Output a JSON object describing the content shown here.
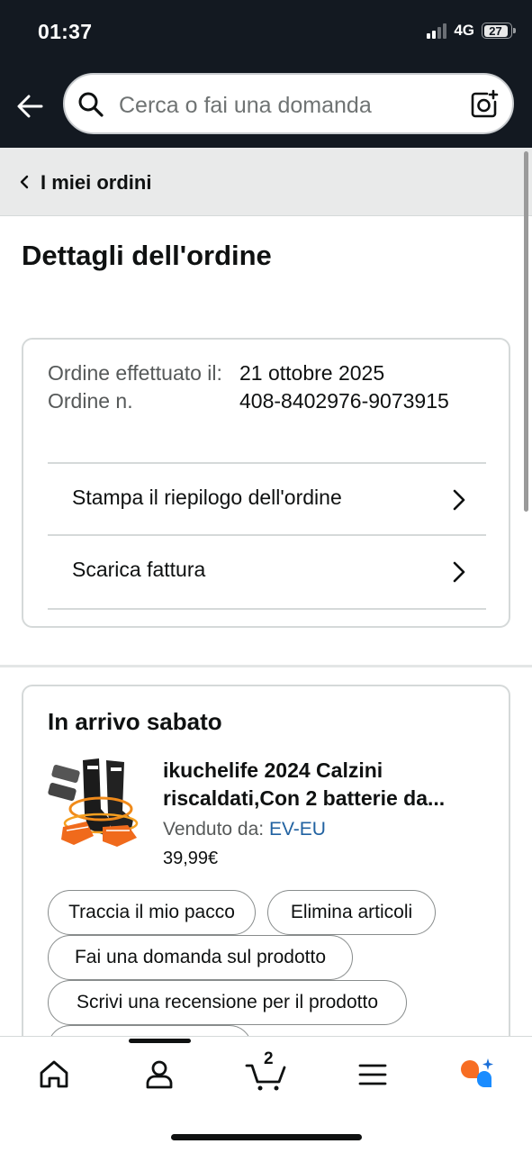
{
  "status_bar": {
    "time": "01:37",
    "network": "4G",
    "battery": "27"
  },
  "search": {
    "placeholder": "Cerca o fai una domanda"
  },
  "breadcrumb": {
    "label": "I miei ordini"
  },
  "page": {
    "title": "Dettagli dell'ordine"
  },
  "order": {
    "date_label": "Ordine effettuato il:",
    "number_label": "Ordine n.",
    "date_value": "21 ottobre 2025",
    "number_value": "408-8402976-9073915",
    "links": [
      {
        "label": "Stampa il riepilogo dell'ordine"
      },
      {
        "label": "Scarica fattura"
      }
    ]
  },
  "shipment": {
    "title": "In arrivo sabato",
    "product": {
      "name_line1": "ikuchelife 2024 Calzini",
      "name_line2": "riscaldati,Con 2 batterie da...",
      "seller_prefix": "Venduto da:",
      "seller_name": "EV-EU",
      "price": "39,99€"
    },
    "actions": [
      {
        "label": "Traccia il mio pacco"
      },
      {
        "label": "Elimina articoli"
      },
      {
        "label": "Fai una domanda sul prodotto"
      },
      {
        "label": "Scrivi una recensione per il prodotto"
      }
    ]
  },
  "bottom_nav": {
    "cart_count": "2",
    "items": [
      "home-icon",
      "account-icon",
      "cart-icon",
      "menu-icon",
      "rufus-ai-icon"
    ]
  },
  "colors": {
    "header_bg": "#131921",
    "link": "#2162a1",
    "ai_orange": "#f76d22",
    "ai_blue": "#1a8cff"
  }
}
